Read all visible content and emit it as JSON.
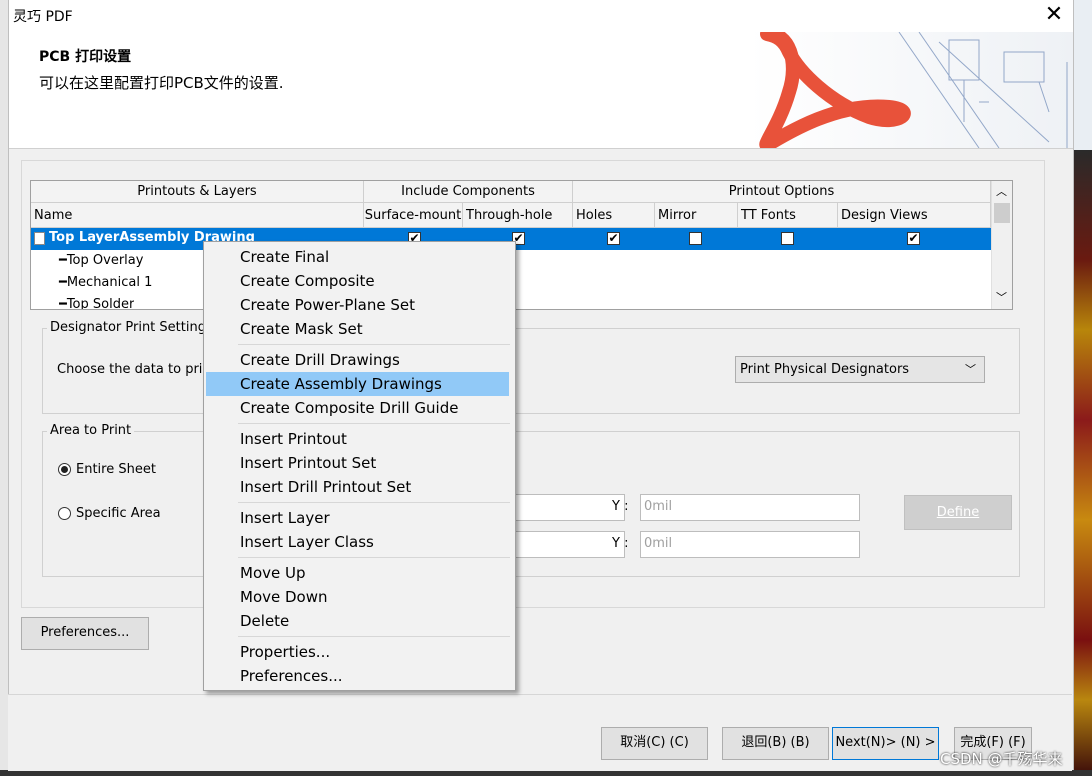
{
  "app": {
    "title": "灵巧 PDF"
  },
  "header": {
    "title": "PCB 打印设置",
    "subtitle": "可以在这里配置打印PCB文件的设置."
  },
  "table": {
    "group_headers": [
      "Printouts & Layers",
      "Include Components",
      "Printout Options"
    ],
    "columns": [
      "Name",
      "Surface-mount",
      "Through-hole",
      "Holes",
      "Mirror",
      "TT Fonts",
      "Design Views"
    ],
    "selected_row": {
      "name": "Top LayerAssembly Drawing",
      "surface_mount": "✔",
      "through_hole": "✔",
      "holes": "✔",
      "mirror": "",
      "tt_fonts": "",
      "design_views": "✔"
    },
    "layers": [
      "Top Overlay",
      "Mechanical 1",
      "Top Solder"
    ]
  },
  "designator": {
    "group_label": "Designator Print Settings",
    "prompt": "Choose the data to prin",
    "dropdown_value": "Print Physical Designators"
  },
  "area": {
    "group_label": "Area to Print",
    "opt_entire": "Entire Sheet",
    "opt_specific": "Specific Area",
    "y_label": "Y :",
    "y_value": "0mil",
    "define_label": "Define"
  },
  "buttons": {
    "preferences": "Preferences...",
    "cancel": "取消(C) (C)",
    "back": "退回(B) (B)",
    "next": "Next(N)> (N) >",
    "finish": "完成(F) (F)"
  },
  "context_menu": {
    "items": [
      "Create Final",
      "Create Composite",
      "Create Power-Plane Set",
      "Create Mask Set",
      "Create Drill Drawings",
      "Create Assembly Drawings",
      "Create Composite Drill Guide",
      "Insert Printout",
      "Insert Printout Set",
      "Insert Drill Printout Set",
      "Insert Layer",
      "Insert Layer Class",
      "Move Up",
      "Move Down",
      "Delete",
      "Properties...",
      "Preferences..."
    ],
    "highlighted": "Create Assembly Drawings"
  },
  "watermark": "CSDN @千殇华来",
  "colors": {
    "selection": "#0078d7",
    "menu_highlight": "#91c9f7",
    "acrobat_red": "#e8523a"
  }
}
